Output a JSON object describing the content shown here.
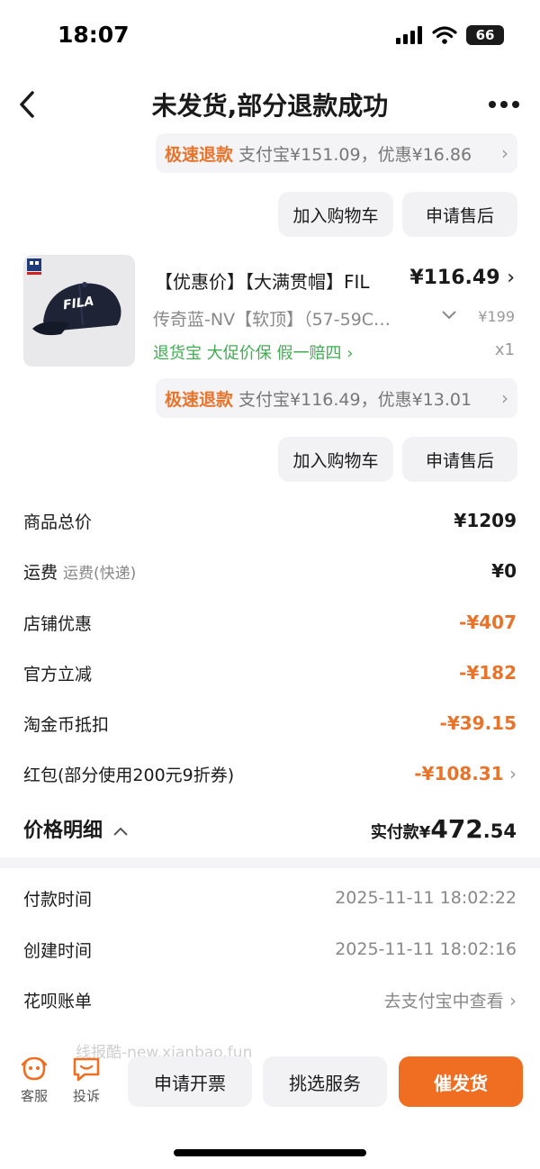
{
  "status": {
    "time": "18:07",
    "battery": "66"
  },
  "nav": {
    "title": "未发货,部分退款成功"
  },
  "item1": {
    "refund_tag": "极速退款",
    "refund_desc": "支付宝¥151.09，优惠¥16.86",
    "add_cart": "加入购物车",
    "after_sale": "申请售后"
  },
  "item2": {
    "title": "【优惠价】【大满贯帽】FIL",
    "price": "¥116.49",
    "sku": "传奇蓝-NV【软顶】（57-59C…",
    "original_price": "¥199",
    "tags": "退货宝  大促价保  假一赔四",
    "qty": "x1",
    "brand": "FILA",
    "refund_tag": "极速退款",
    "refund_desc": "支付宝¥116.49，优惠¥13.01",
    "add_cart": "加入购物车",
    "after_sale": "申请售后"
  },
  "fees": {
    "total_label": "商品总价",
    "total_value": "¥1209",
    "shipping_label": "运费",
    "shipping_sub": "运费(快递)",
    "shipping_value": "¥0",
    "shop_label": "店铺优惠",
    "shop_value": "-¥407",
    "official_label": "官方立减",
    "official_value": "-¥182",
    "coin_label": "淘金币抵扣",
    "coin_value": "-¥39.15",
    "redpack_label": "红包(部分使用200元9折券)",
    "redpack_value": "-¥108.31"
  },
  "detail": {
    "title": "价格明细",
    "paid_label": "实付款¥",
    "paid_int": "472",
    "paid_dec": ".54"
  },
  "info": {
    "pay_time_label": "付款时间",
    "pay_time": "2025-11-11 18:02:22",
    "create_time_label": "创建时间",
    "create_time": "2025-11-11 18:02:16",
    "huabei_label": "花呗账单",
    "huabei_value": "去支付宝中查看"
  },
  "bottom": {
    "watermark": "线报酷-new.xianbao.fun",
    "service_label": "客服",
    "complain_label": "投诉",
    "invoice": "申请开票",
    "pick_service": "挑选服务",
    "urge": "催发货"
  },
  "colors": {
    "accent": "#f06e22",
    "price_orange": "#e8742c",
    "green_tag": "#3fae52"
  }
}
